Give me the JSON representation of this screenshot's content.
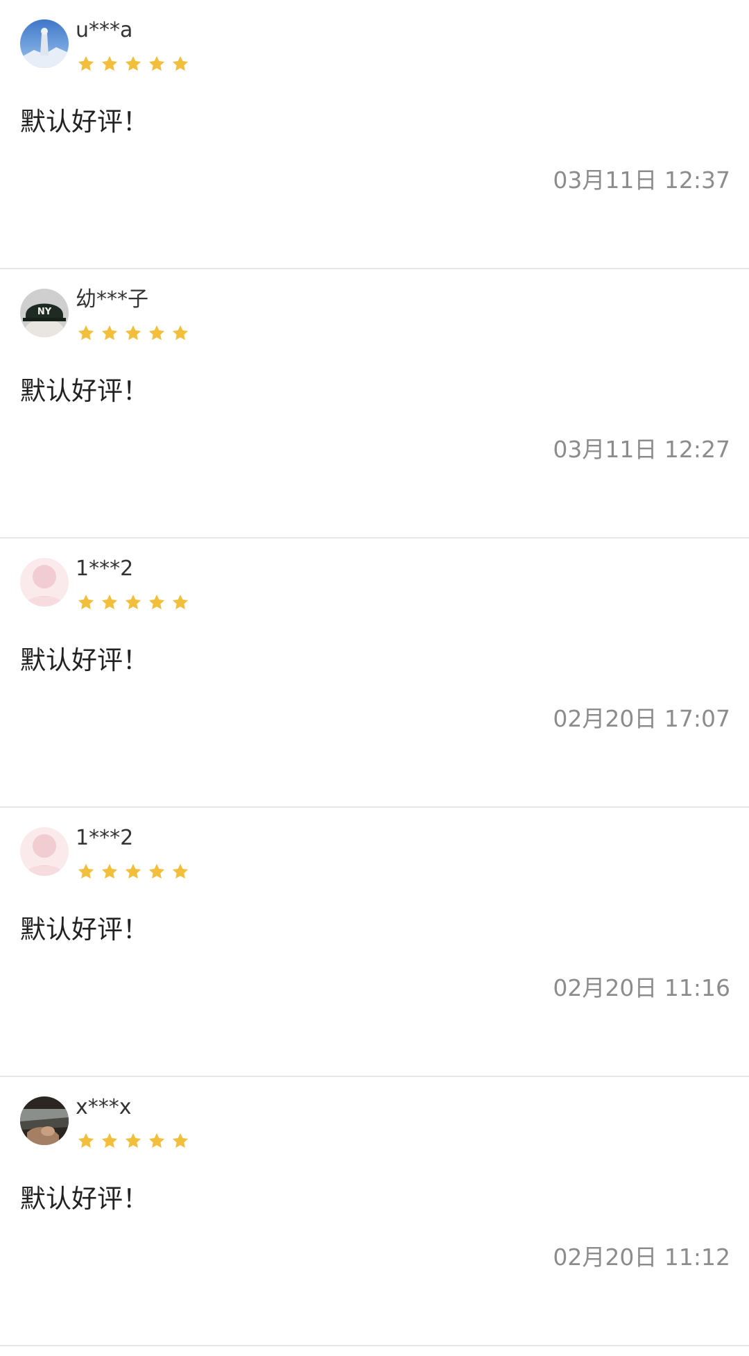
{
  "colors": {
    "star": "#F1BF3C",
    "divider": "#E6E6E6",
    "timestamp": "#8C8C8C"
  },
  "reviews": [
    {
      "avatar_icon": "avatar-photo-landscape",
      "username": "u***a",
      "rating": 5,
      "comment": "默认好评！",
      "time": "03月11日 12:37"
    },
    {
      "avatar_icon": "avatar-photo-cap",
      "username": "幼***子",
      "rating": 5,
      "comment": "默认好评！",
      "time": "03月11日 12:27"
    },
    {
      "avatar_icon": "avatar-default-icon",
      "username": "1***2",
      "rating": 5,
      "comment": "默认好评！",
      "time": "02月20日 17:07"
    },
    {
      "avatar_icon": "avatar-default-icon",
      "username": "1***2",
      "rating": 5,
      "comment": "默认好评！",
      "time": "02月20日 11:16"
    },
    {
      "avatar_icon": "avatar-photo-dark",
      "username": "x***x",
      "rating": 5,
      "comment": "默认好评！",
      "time": "02月20日 11:12"
    }
  ]
}
